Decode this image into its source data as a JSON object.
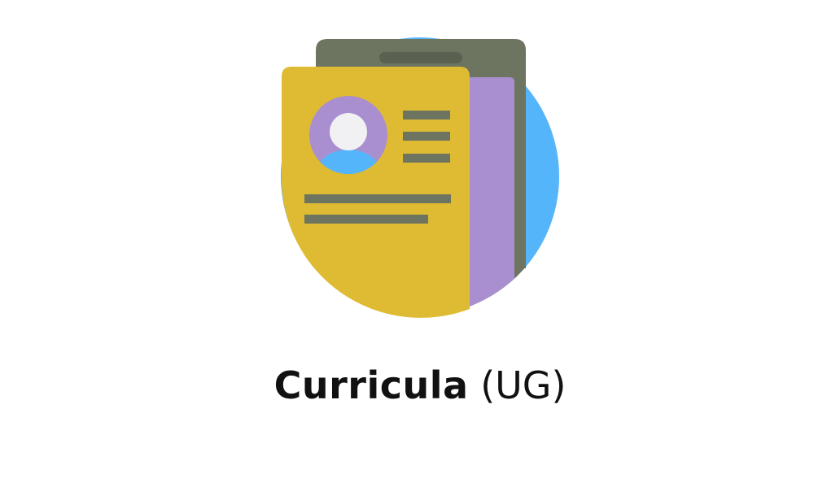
{
  "icon": {
    "name": "curriculum-document-icon",
    "colors": {
      "circle_blue": "#55b5fb",
      "back_sheet": "#6d745f",
      "mid_sheet": "#a98fcf",
      "front_sheet": "#dfbb33",
      "lines": "#6d745f",
      "avatar_ring": "#a98fcf",
      "avatar_head": "#f1f1f3",
      "avatar_body": "#55b5fb"
    }
  },
  "caption": {
    "main": "Curricula",
    "suffix": "(UG)"
  }
}
